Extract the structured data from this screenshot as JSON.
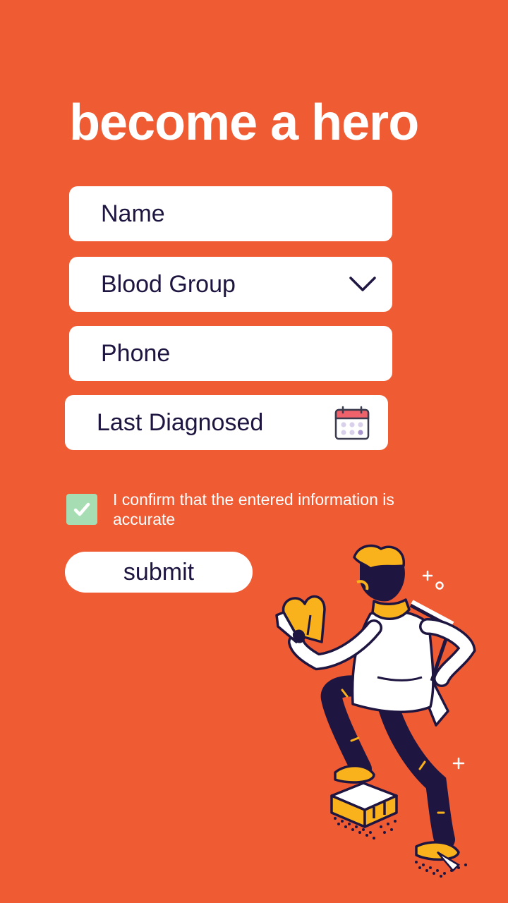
{
  "page": {
    "title": "become a hero",
    "background_color": "#EF5B33"
  },
  "form": {
    "name_placeholder": "Name",
    "blood_group_label": "Blood Group",
    "phone_placeholder": "Phone",
    "last_diagnosed_label": "Last Diagnosed",
    "confirm_checked": true,
    "confirm_text": "I confirm that the entered information is accurate",
    "submit_label": "submit"
  },
  "icons": {
    "blood_group": "chevron-down-icon",
    "last_diagnosed": "calendar-icon",
    "confirm": "checkmark-icon"
  },
  "colors": {
    "accent": "#EF5B33",
    "text_dark": "#1E1540",
    "checkbox_fill": "#A6DDB2",
    "illustration_yellow": "#F9B21C"
  }
}
